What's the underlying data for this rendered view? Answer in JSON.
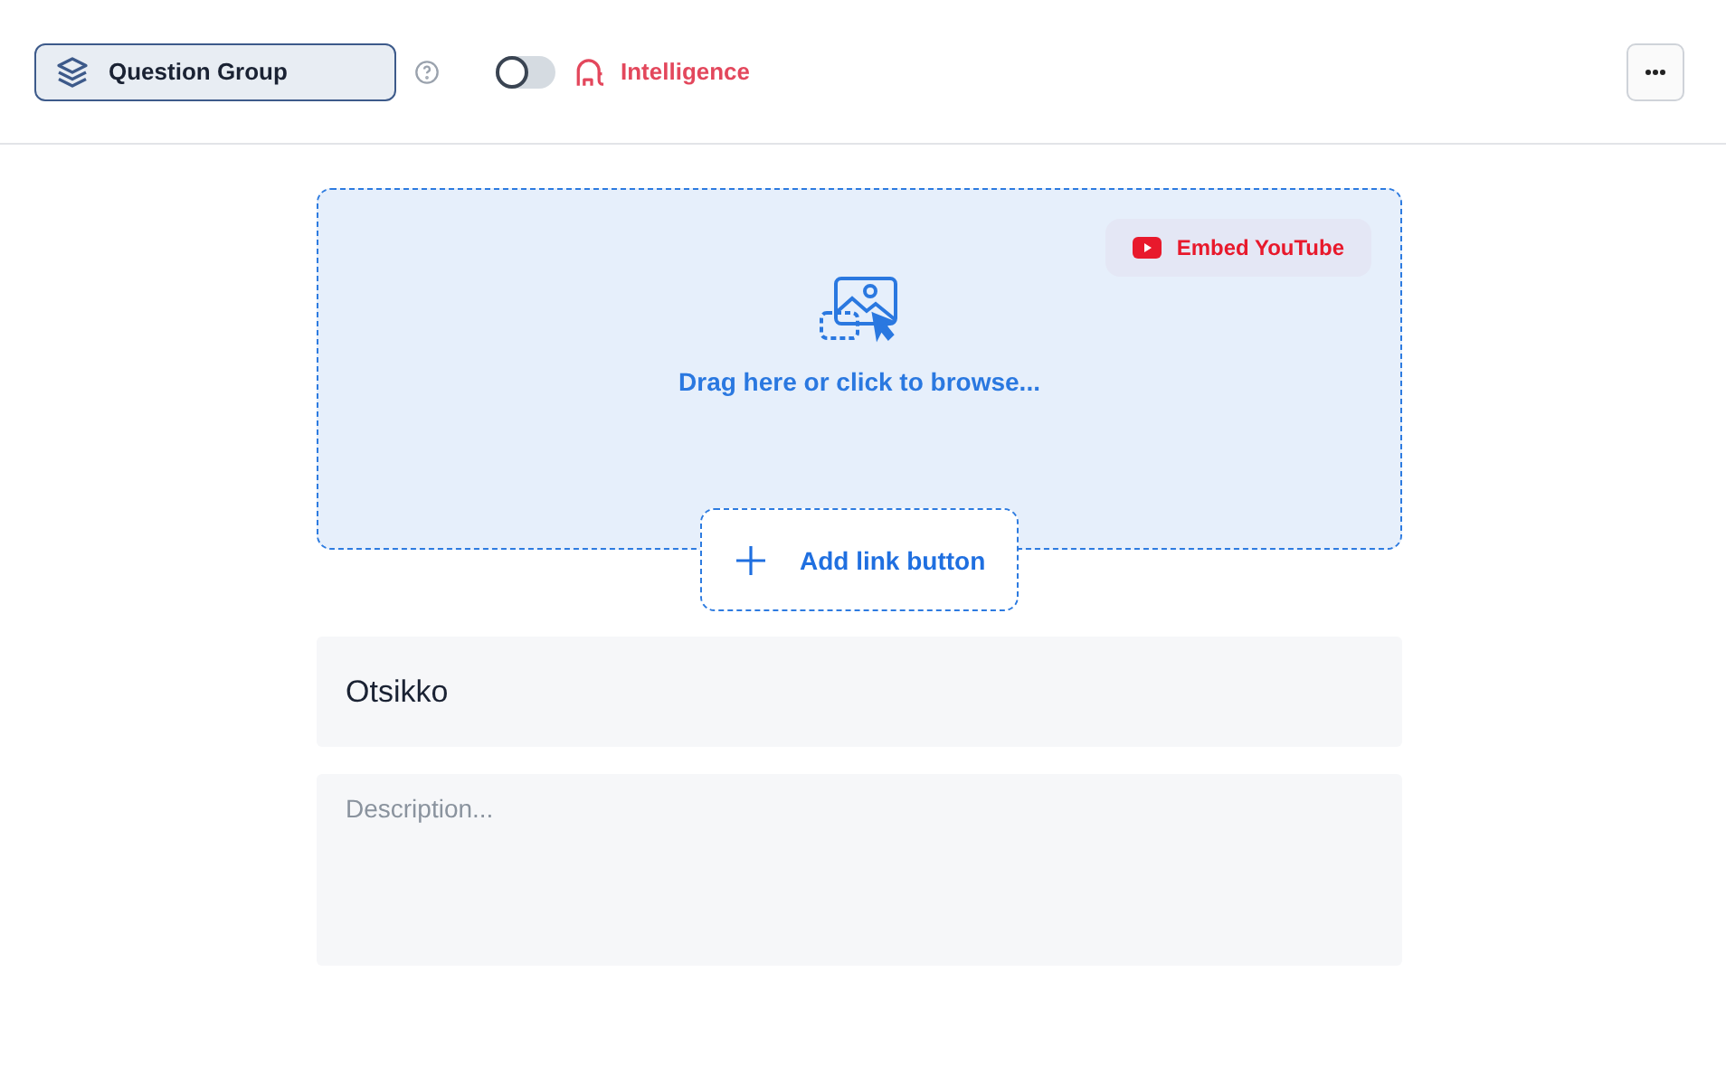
{
  "header": {
    "group_button": "Question Group",
    "intelligence": {
      "label": "Intelligence",
      "on": false
    }
  },
  "media": {
    "embed_button": "Embed YouTube",
    "drop_hint": "Drag here or click to browse...",
    "add_link_button": "Add link button"
  },
  "title_field": {
    "value": "Otsikko"
  },
  "description_field": {
    "placeholder": "Description..."
  }
}
